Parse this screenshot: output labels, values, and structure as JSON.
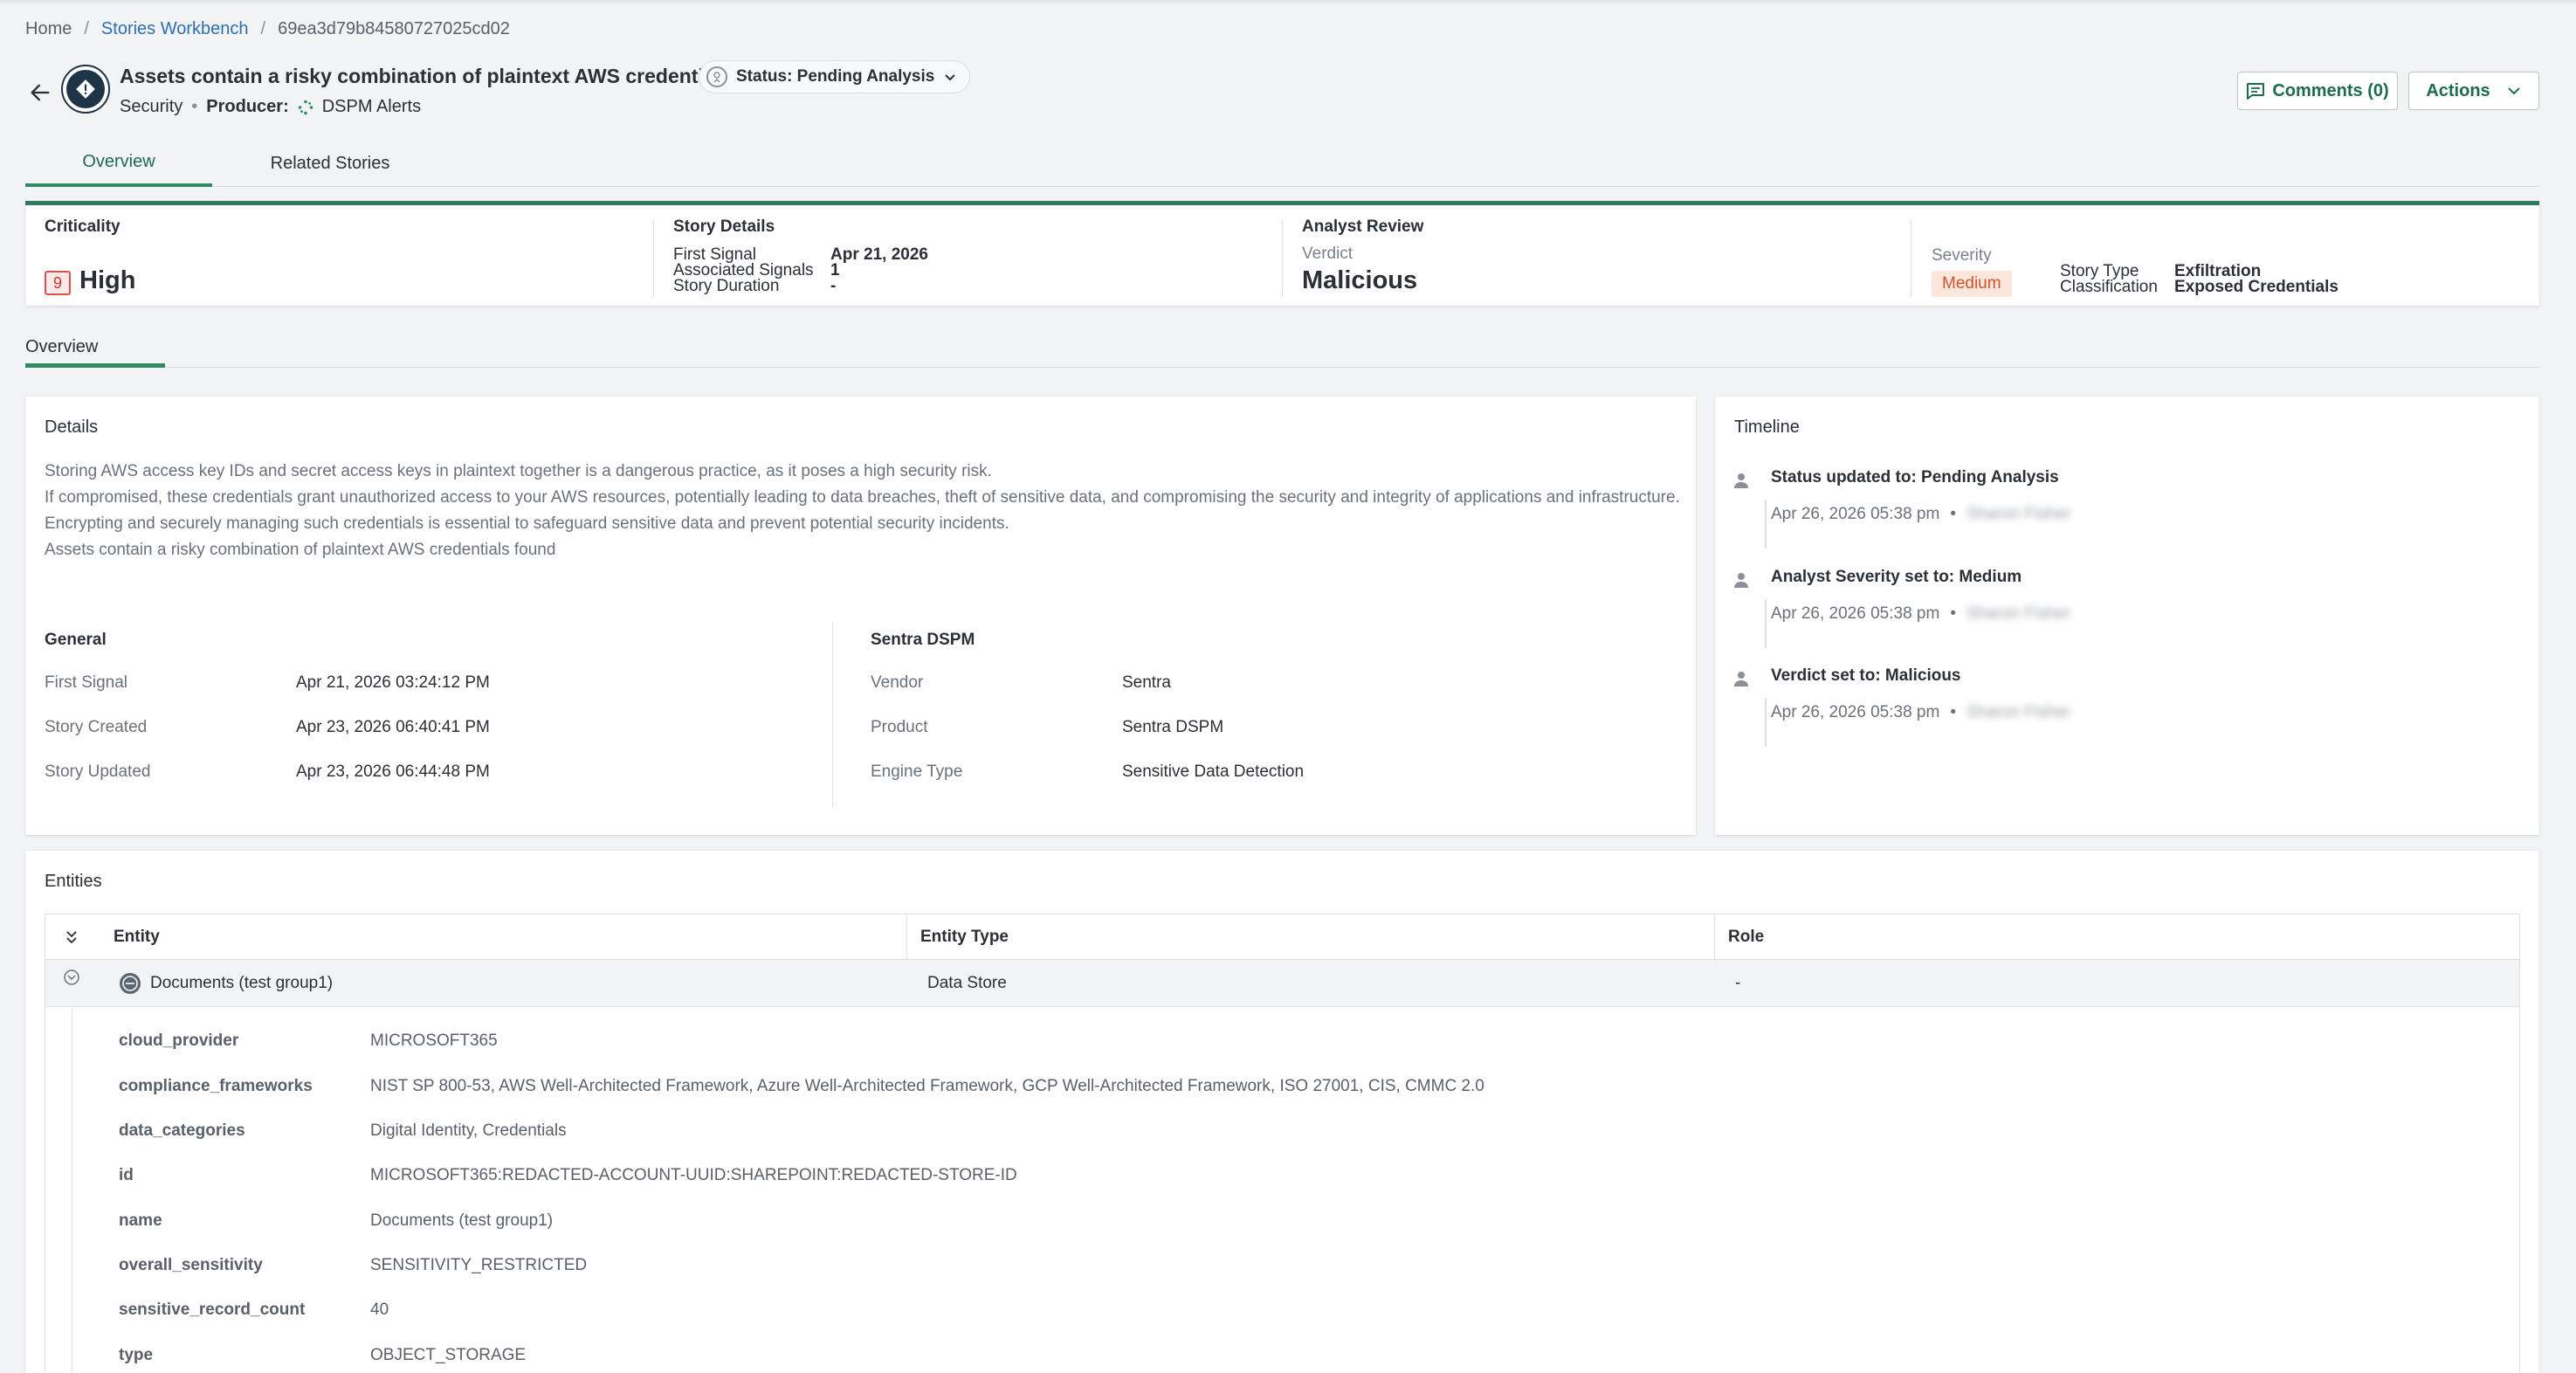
{
  "breadcrumb": {
    "home": "Home",
    "workbench": "Stories Workbench",
    "id": "69ea3d79b84580727025cd02",
    "sep": "/"
  },
  "header": {
    "title": "Assets contain a risky combination of plaintext AWS credentials",
    "status": "Status: Pending Analysis",
    "category": "Security",
    "producer_label": "Producer:",
    "producer": "DSPM Alerts",
    "comments_button": "Comments (0)",
    "actions_button": "Actions"
  },
  "tabs": [
    {
      "label": "Overview"
    },
    {
      "label": "Related Stories"
    }
  ],
  "summary": {
    "criticality_label": "Criticality",
    "criticality_score": "9",
    "criticality_value": "High",
    "story_details_label": "Story Details",
    "first_signal_label": "First Signal",
    "first_signal_value": "Apr 21, 2026",
    "associated_signals_label": "Associated Signals",
    "associated_signals_value": "1",
    "story_duration_label": "Story Duration",
    "story_duration_value": "-",
    "analyst_review_label": "Analyst Review",
    "verdict_label": "Verdict",
    "verdict_value": "Malicious",
    "severity_label": "Severity",
    "severity_value": "Medium",
    "story_type_label": "Story Type",
    "story_type_value": "Exfiltration",
    "classification_label": "Classification",
    "classification_value": "Exposed Credentials"
  },
  "subtabs": [
    {
      "label": "Overview"
    }
  ],
  "details": {
    "title": "Details",
    "paragraphs": [
      "Storing AWS access key IDs and secret access keys in plaintext together is a dangerous practice, as it poses a high security risk.",
      "If compromised, these credentials grant unauthorized access to your AWS resources, potentially leading to data breaches, theft of sensitive data, and compromising the security and integrity of applications and infrastructure.",
      "Encrypting and securely managing such credentials is essential to safeguard sensitive data and prevent potential security incidents.",
      "Assets contain a risky combination of plaintext AWS credentials found"
    ],
    "general": {
      "title": "General",
      "rows": [
        {
          "label": "First Signal",
          "value": "Apr 21, 2026 03:24:12 PM"
        },
        {
          "label": "Story Created",
          "value": "Apr 23, 2026 06:40:41 PM"
        },
        {
          "label": "Story Updated",
          "value": "Apr 23, 2026 06:44:48 PM"
        }
      ]
    },
    "vendor_section": {
      "title": "Sentra DSPM",
      "rows": [
        {
          "label": "Vendor",
          "value": "Sentra"
        },
        {
          "label": "Product",
          "value": "Sentra DSPM"
        },
        {
          "label": "Engine Type",
          "value": "Sensitive Data Detection"
        }
      ]
    }
  },
  "timeline": {
    "title": "Timeline",
    "items": [
      {
        "title": "Status updated to: Pending Analysis",
        "time": "Apr 26, 2026 05:38 pm",
        "sep": "•",
        "user": "Sharon Fisher"
      },
      {
        "title": "Analyst Severity set to: Medium",
        "time": "Apr 26, 2026 05:38 pm",
        "sep": "•",
        "user": "Sharon Fisher"
      },
      {
        "title": "Verdict set to: Malicious",
        "time": "Apr 26, 2026 05:38 pm",
        "sep": "•",
        "user": "Sharon Fisher"
      }
    ]
  },
  "entities": {
    "title": "Entities",
    "columns": [
      "Entity",
      "Entity Type",
      "Role"
    ],
    "row": {
      "entity": "Documents (test group1)",
      "type": "Data Store",
      "role": "-"
    },
    "attributes": [
      {
        "key": "cloud_provider",
        "value": "MICROSOFT365"
      },
      {
        "key": "compliance_frameworks",
        "value": "NIST SP 800-53, AWS Well-Architected Framework, Azure Well-Architected Framework, GCP Well-Architected Framework, ISO 27001, CIS, CMMC 2.0"
      },
      {
        "key": "data_categories",
        "value": "Digital Identity, Credentials"
      },
      {
        "key": "id",
        "value": "MICROSOFT365:REDACTED-ACCOUNT-UUID:SHAREPOINT:REDACTED-STORE-ID"
      },
      {
        "key": "name",
        "value": "Documents (test group1)"
      },
      {
        "key": "overall_sensitivity",
        "value": "SENSITIVITY_RESTRICTED"
      },
      {
        "key": "sensitive_record_count",
        "value": "40"
      },
      {
        "key": "type",
        "value": "OBJECT_STORAGE"
      }
    ]
  },
  "colors": {
    "accent": "#2f8b62",
    "link": "#2f6fb0",
    "danger": "#d9534f",
    "warning": "#d3542a"
  },
  "icons": {
    "back": "arrow-left-icon",
    "story": "alert-diamond-icon",
    "status": "status-badge-icon",
    "comments": "comment-icon",
    "actions": "chevron-down-icon",
    "timeline": "user-icon",
    "collapse_all": "double-chevron-icon",
    "row_toggle": "chevron-circle-icon",
    "entity": "data-store-icon"
  }
}
